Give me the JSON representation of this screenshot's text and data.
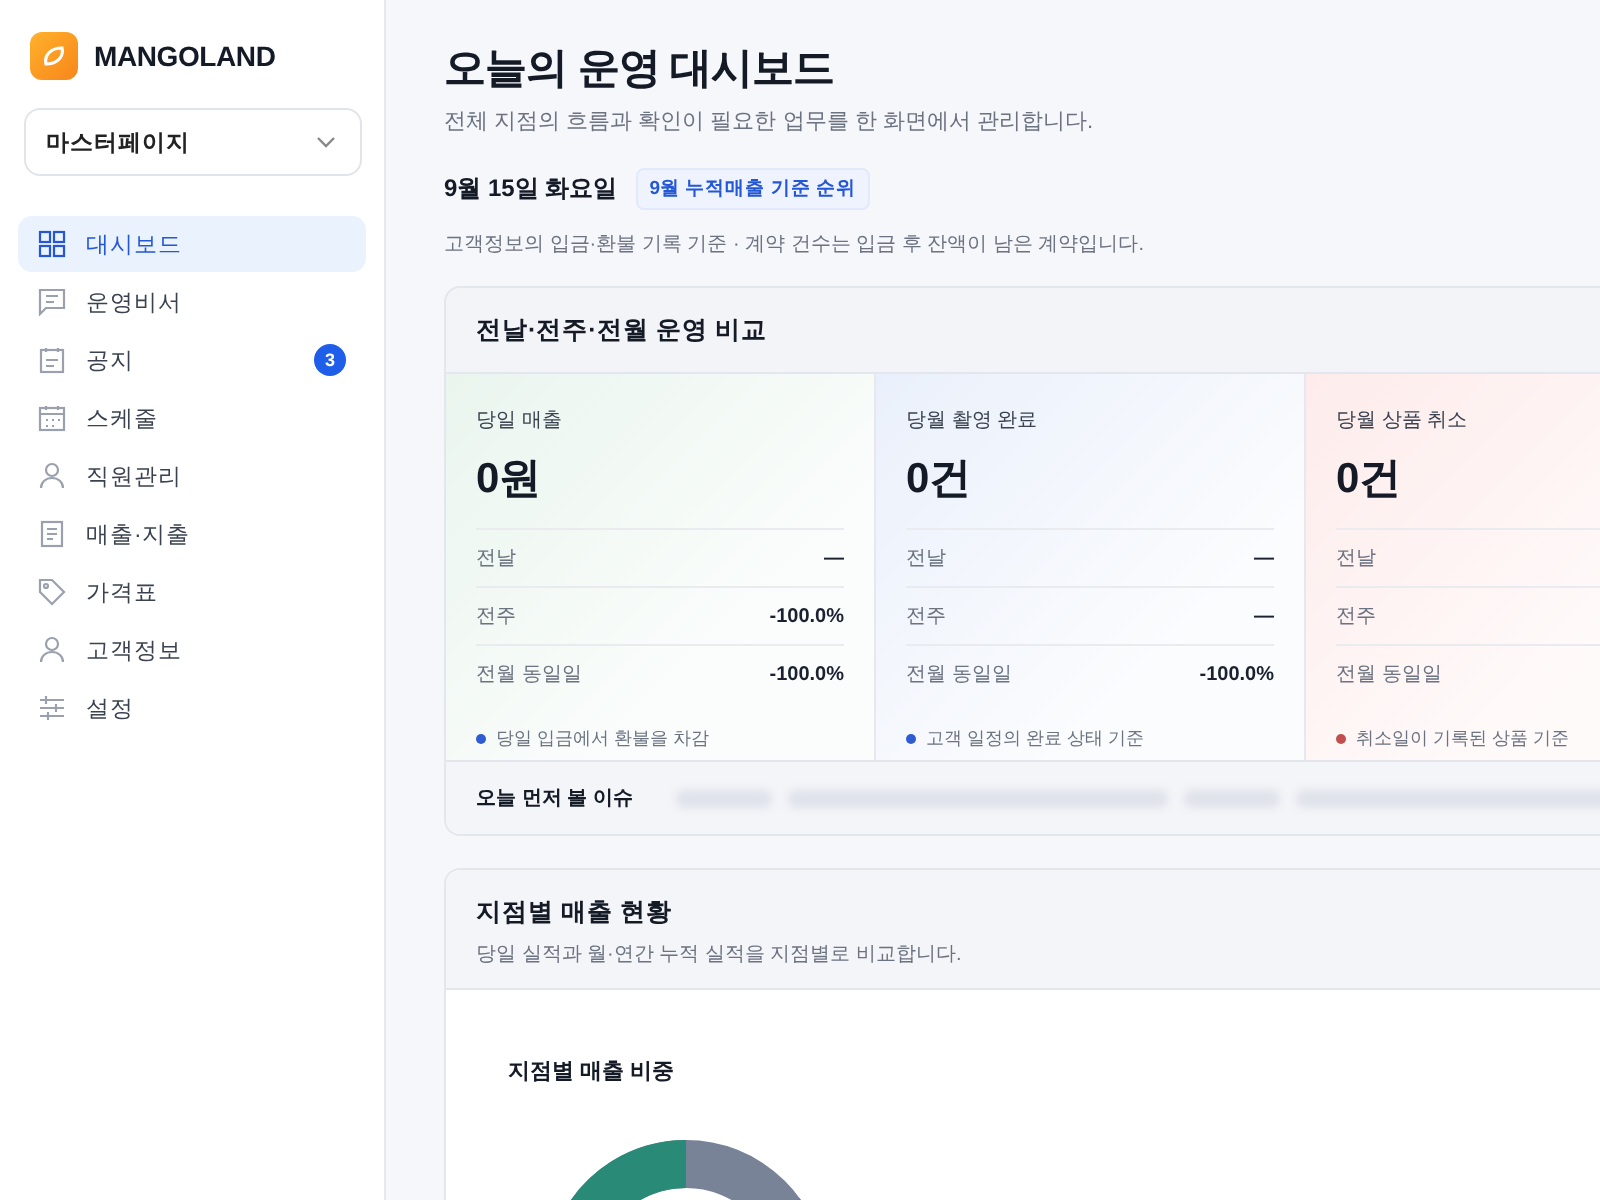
{
  "brand": {
    "name": "MANGOLAND"
  },
  "site_select": {
    "value": "마스터페이지"
  },
  "sidebar": {
    "items": [
      {
        "label": "대시보드",
        "selected": true
      },
      {
        "label": "운영비서",
        "selected": false
      },
      {
        "label": "공지",
        "selected": false,
        "badge": "3"
      },
      {
        "label": "스케줄",
        "selected": false
      },
      {
        "label": "직원관리",
        "selected": false
      },
      {
        "label": "매출·지출",
        "selected": false
      },
      {
        "label": "가격표",
        "selected": false
      },
      {
        "label": "고객정보",
        "selected": false
      },
      {
        "label": "설정",
        "selected": false
      }
    ]
  },
  "header": {
    "title": "오늘의 운영 대시보드",
    "subtitle": "전체 지점의 흐름과 확인이 필요한 업무를 한 화면에서 관리합니다.",
    "date": "9월 15일 화요일",
    "tag": "9월 누적매출 기준 순위",
    "note": "고객정보의 입금·환불 기록 기준 · 계약 건수는 입금 후 잔액이 남은 계약입니다."
  },
  "comparison": {
    "title": "전날·전주·전월 운영 비교",
    "cards": [
      {
        "kind": "green",
        "label": "당일 매출",
        "value": "0원",
        "rows": [
          {
            "label": "전날",
            "value": "—"
          },
          {
            "label": "전주",
            "value": "-100.0%"
          },
          {
            "label": "전월 동일일",
            "value": "-100.0%"
          }
        ],
        "footnote": "당일 입금에서 환불을 차감",
        "color": "#2f5bd3"
      },
      {
        "kind": "blue",
        "label": "당월 촬영 완료",
        "value": "0건",
        "rows": [
          {
            "label": "전날",
            "value": "—"
          },
          {
            "label": "전주",
            "value": "—"
          },
          {
            "label": "전월 동일일",
            "value": "-100.0%"
          }
        ],
        "footnote": "고객 일정의 완료 상태 기준",
        "color": "#2f5bd3"
      },
      {
        "kind": "red",
        "label": "당월 상품 취소",
        "value": "0건",
        "rows": [
          {
            "label": "전날"
          },
          {
            "label": "전주"
          },
          {
            "label": "전월 동일일"
          }
        ],
        "footnote": "취소일이 기록된 상품 기준",
        "color": "#c0504d"
      }
    ],
    "issues_label": "오늘 먼저 볼 이슈"
  },
  "branch_sales": {
    "title": "지점별 매출 현황",
    "subtitle": "당일 실적과 월·연간 누적 실적을 지점별로 비교합니다.",
    "chart_title": "지점별 매출 비중"
  }
}
